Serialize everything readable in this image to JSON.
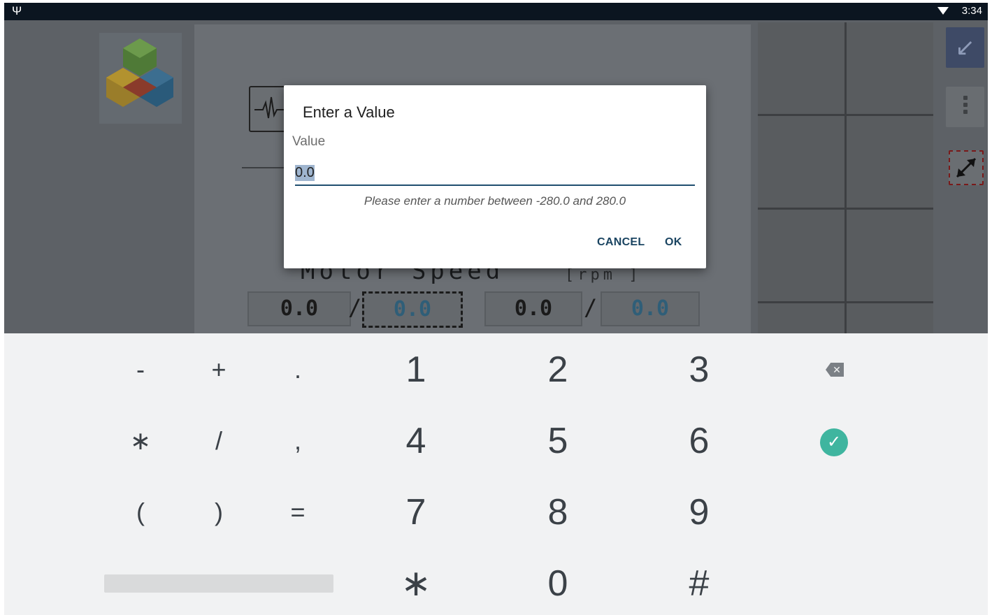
{
  "status_bar": {
    "usb_icon": "Ψ",
    "time": "3:34"
  },
  "app": {
    "motor_label": "Motor Speed",
    "unit_label": "[rpm          ]",
    "values": [
      {
        "actual": "0.0",
        "set": "0.0"
      },
      {
        "actual": "0.0",
        "set": "0.0"
      }
    ],
    "slash": "/",
    "side_button_icon": "↙"
  },
  "dialog": {
    "title": "Enter a Value",
    "label": "Value",
    "input_value": "0.0",
    "hint": "Please enter a number between -280.0 and 280.0",
    "cancel_label": "CANCEL",
    "ok_label": "OK"
  },
  "keyboard": {
    "row1": [
      "-",
      "+",
      ".",
      "1",
      "2",
      "3"
    ],
    "row2": [
      "∗",
      "/",
      ",",
      "4",
      "5",
      "6"
    ],
    "row3": [
      "(",
      ")",
      "=",
      "7",
      "8",
      "9"
    ],
    "row4": [
      "∗",
      "0",
      "#"
    ],
    "backspace_glyph": "✕",
    "enter_glyph": "✓"
  },
  "colors": {
    "accent": "#1f4e6f",
    "enter": "#3fb59f",
    "scrim": "#5d6166"
  }
}
